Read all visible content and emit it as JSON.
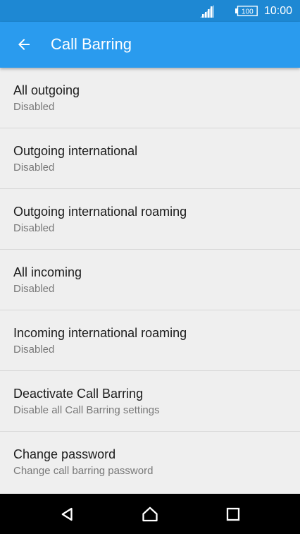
{
  "status_bar": {
    "battery_level": "100",
    "time": "10:00",
    "signal_icon": "signal-icon",
    "battery_icon": "battery-icon"
  },
  "app_bar": {
    "title": "Call Barring",
    "back_icon": "arrow-back-icon"
  },
  "settings": {
    "items": [
      {
        "title": "All outgoing",
        "subtitle": "Disabled"
      },
      {
        "title": "Outgoing international",
        "subtitle": "Disabled"
      },
      {
        "title": "Outgoing international roaming",
        "subtitle": "Disabled"
      },
      {
        "title": "All incoming",
        "subtitle": "Disabled"
      },
      {
        "title": "Incoming international roaming",
        "subtitle": "Disabled"
      },
      {
        "title": "Deactivate Call Barring",
        "subtitle": "Disable all Call Barring settings"
      },
      {
        "title": "Change password",
        "subtitle": "Change call barring password"
      }
    ]
  },
  "nav_bar": {
    "back_icon": "nav-back-icon",
    "home_icon": "nav-home-icon",
    "recents_icon": "nav-recents-icon"
  },
  "colors": {
    "status_bar": "#1e88d3",
    "app_bar": "#2a9bee",
    "background": "#efefef",
    "divider": "#d8d8d8",
    "primary_text": "#1c1c1c",
    "secondary_text": "#787878",
    "nav_bar": "#000000"
  }
}
